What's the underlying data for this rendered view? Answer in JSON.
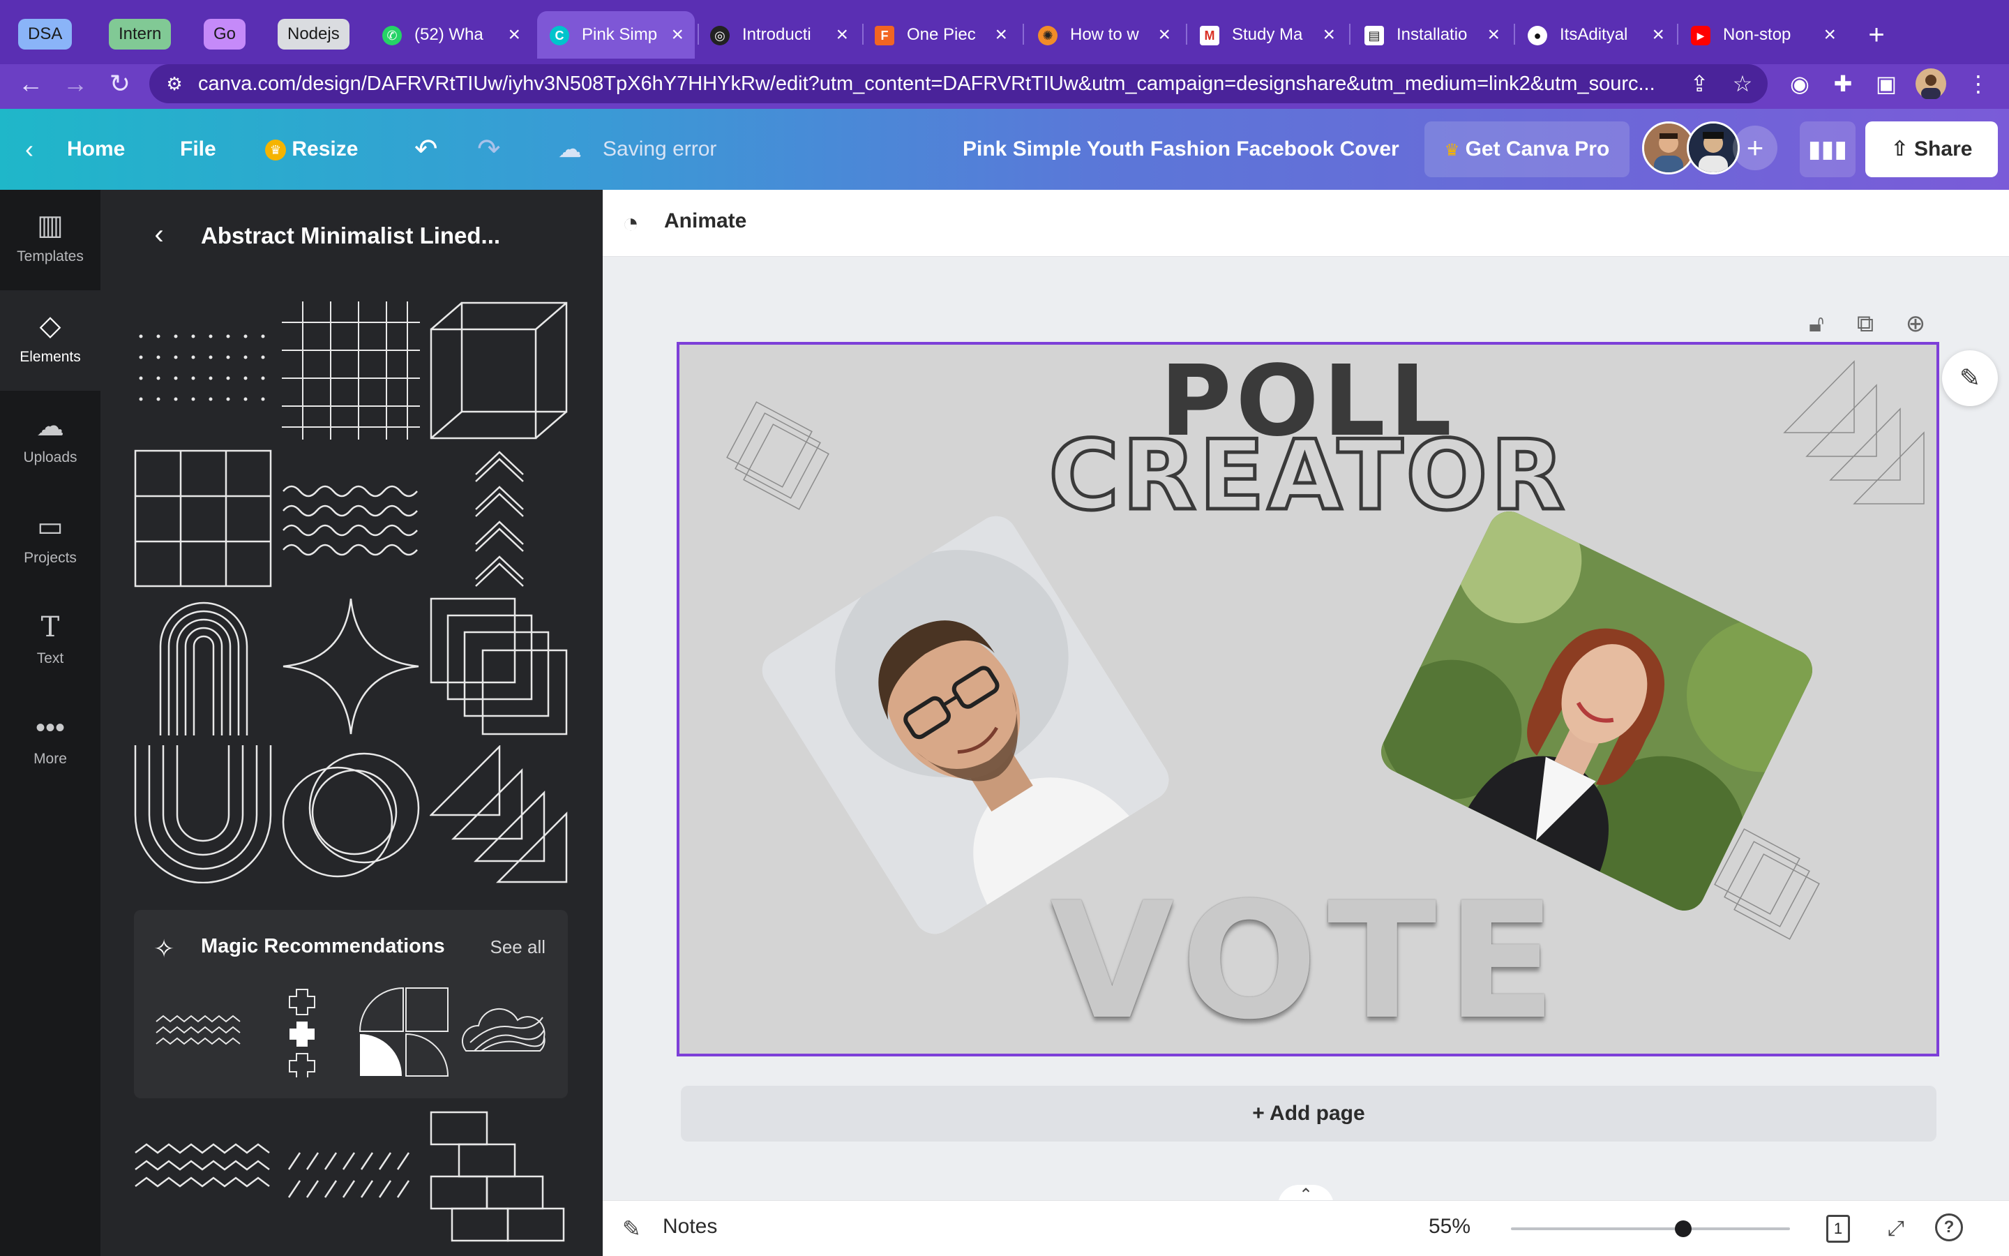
{
  "browser": {
    "tab_groups": [
      {
        "label": "DSA",
        "color": "#8ab4f8"
      },
      {
        "label": "Intern",
        "color": "#81c995"
      },
      {
        "label": "Go",
        "color": "#c58af9"
      },
      {
        "label": "Nodejs",
        "color": "#dadce0"
      }
    ],
    "tabs": [
      {
        "title": "(52) Wha",
        "icon": "whatsapp-icon"
      },
      {
        "title": "Pink Simp",
        "icon": "canva-icon",
        "active": true
      },
      {
        "title": "Introducti",
        "icon": "github-copilot-icon"
      },
      {
        "title": "One Piec",
        "icon": "flaticon-icon"
      },
      {
        "title": "How to w",
        "icon": "openai-icon"
      },
      {
        "title": "Study Ma",
        "icon": "gmail-icon"
      },
      {
        "title": "Installatio",
        "icon": "docs-icon"
      },
      {
        "title": "ItsAdityal",
        "icon": "github-icon"
      },
      {
        "title": "Non-stop",
        "icon": "youtube-icon"
      }
    ],
    "url": "canva.com/design/DAFRVRtTIUw/iyhv3N508TpX6hY7HHYkRw/edit?utm_content=DAFRVRtTIUw&utm_campaign=designshare&utm_medium=link2&utm_sourc..."
  },
  "header": {
    "home": "Home",
    "file": "File",
    "resize": "Resize",
    "status": "Saving error",
    "document_title": "Pink Simple Youth Fashion Facebook Cover",
    "pro": "Get Canva Pro",
    "share": "Share"
  },
  "rail": [
    {
      "label": "Templates",
      "icon": "templates-icon"
    },
    {
      "label": "Elements",
      "icon": "elements-icon",
      "active": true
    },
    {
      "label": "Uploads",
      "icon": "upload-icon"
    },
    {
      "label": "Projects",
      "icon": "folder-icon"
    },
    {
      "label": "Text",
      "icon": "text-icon"
    },
    {
      "label": "More",
      "icon": "more-icon"
    }
  ],
  "panel": {
    "title": "Abstract Minimalist Lined...",
    "magic_title": "Magic Recommendations",
    "see_all": "See all"
  },
  "editor": {
    "animate": "Animate",
    "design": {
      "line1": "POLL",
      "line2": "CREATOR",
      "line3": "VOTE"
    },
    "add_page": "+ Add page",
    "notes": "Notes",
    "zoom": "55%",
    "zoom_fraction": 0.55,
    "page_number": "1"
  }
}
